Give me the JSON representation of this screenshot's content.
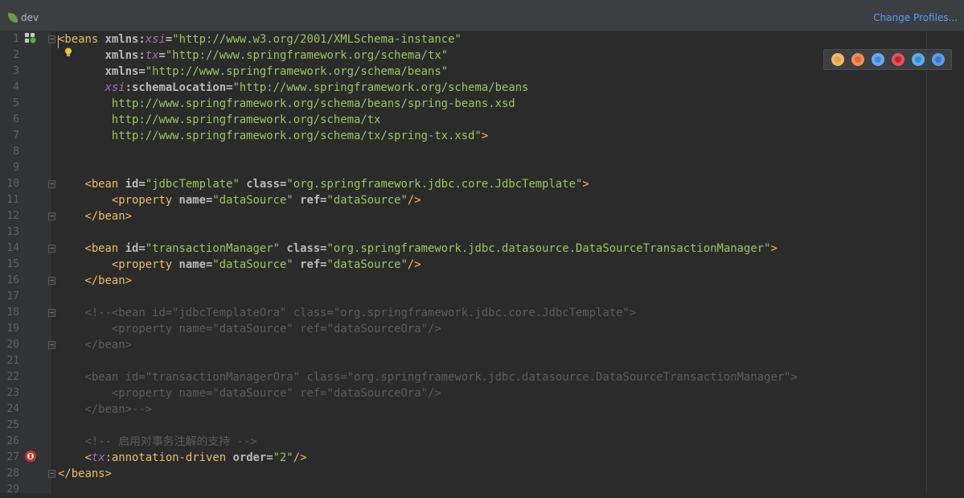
{
  "topbar": {
    "profile_label": "dev",
    "change_profiles_label": "Change Profiles..."
  },
  "browsers": [
    {
      "name": "chrome-icon",
      "color": "#e8a33a"
    },
    {
      "name": "firefox-icon",
      "color": "#e46a28"
    },
    {
      "name": "safari-icon",
      "color": "#3c8be0"
    },
    {
      "name": "opera-icon",
      "color": "#cc1f2a"
    },
    {
      "name": "ie-icon",
      "color": "#2d8fe0"
    },
    {
      "name": "edge-icon",
      "color": "#2b7bd6"
    }
  ],
  "lines": [
    {
      "n": "1",
      "parts": [
        [
          "t-tag",
          "<beans "
        ],
        [
          "t-attr",
          "xmlns:"
        ],
        [
          "t-ns",
          "xsi"
        ],
        [
          "t-attr",
          "="
        ],
        [
          "val",
          "\"http://www.w3.org/2001/XMLSchema-instance\""
        ]
      ]
    },
    {
      "n": "2",
      "parts": [
        [
          "t-plain",
          "       "
        ],
        [
          "t-attr",
          "xmlns:"
        ],
        [
          "t-ns",
          "tx"
        ],
        [
          "t-attr",
          "="
        ],
        [
          "val",
          "\"http://www.springframework.org/schema/tx\""
        ]
      ]
    },
    {
      "n": "3",
      "parts": [
        [
          "t-plain",
          "       "
        ],
        [
          "t-attr",
          "xmlns"
        ],
        [
          "t-attr",
          "="
        ],
        [
          "val",
          "\"http://www.springframework.org/schema/beans\""
        ]
      ]
    },
    {
      "n": "4",
      "parts": [
        [
          "t-plain",
          "       "
        ],
        [
          "t-ns",
          "xsi"
        ],
        [
          "t-attr",
          ":schemaLocation="
        ],
        [
          "val",
          "\"http://www.springframework.org/schema/beans"
        ]
      ]
    },
    {
      "n": "5",
      "parts": [
        [
          "val",
          "        http://www.springframework.org/schema/beans/spring-beans.xsd"
        ]
      ]
    },
    {
      "n": "6",
      "parts": [
        [
          "val",
          "        http://www.springframework.org/schema/tx"
        ]
      ]
    },
    {
      "n": "7",
      "parts": [
        [
          "val",
          "        http://www.springframework.org/schema/tx/spring-tx.xsd\""
        ],
        [
          "t-tag",
          ">"
        ]
      ]
    },
    {
      "n": "8",
      "parts": []
    },
    {
      "n": "9",
      "parts": []
    },
    {
      "n": "10",
      "parts": [
        [
          "t-plain",
          "    "
        ],
        [
          "t-tag",
          "<bean "
        ],
        [
          "t-attr",
          "id="
        ],
        [
          "val",
          "\"jdbcTemplate\" "
        ],
        [
          "t-attr",
          "class="
        ],
        [
          "val",
          "\"org.springframework.jdbc.core.JdbcTemplate\""
        ],
        [
          "t-tag",
          ">"
        ]
      ]
    },
    {
      "n": "11",
      "parts": [
        [
          "t-plain",
          "        "
        ],
        [
          "t-tag",
          "<property "
        ],
        [
          "t-attr",
          "name="
        ],
        [
          "val",
          "\"dataSource\" "
        ],
        [
          "t-attr",
          "ref="
        ],
        [
          "val",
          "\"dataSource\""
        ],
        [
          "t-tag",
          "/>"
        ]
      ]
    },
    {
      "n": "12",
      "parts": [
        [
          "t-plain",
          "    "
        ],
        [
          "t-tag",
          "</bean>"
        ]
      ]
    },
    {
      "n": "13",
      "parts": []
    },
    {
      "n": "14",
      "parts": [
        [
          "t-plain",
          "    "
        ],
        [
          "t-tag",
          "<bean "
        ],
        [
          "t-attr",
          "id="
        ],
        [
          "val",
          "\"transactionManager\" "
        ],
        [
          "t-attr",
          "class="
        ],
        [
          "val",
          "\"org.springframework.jdbc.datasource.DataSourceTransactionManager\""
        ],
        [
          "t-tag",
          ">"
        ]
      ]
    },
    {
      "n": "15",
      "parts": [
        [
          "t-plain",
          "        "
        ],
        [
          "t-tag",
          "<property "
        ],
        [
          "t-attr",
          "name="
        ],
        [
          "val",
          "\"dataSource\" "
        ],
        [
          "t-attr",
          "ref="
        ],
        [
          "val",
          "\"dataSource\""
        ],
        [
          "t-tag",
          "/>"
        ]
      ]
    },
    {
      "n": "16",
      "parts": [
        [
          "t-plain",
          "    "
        ],
        [
          "t-tag",
          "</bean>"
        ]
      ]
    },
    {
      "n": "17",
      "parts": []
    },
    {
      "n": "18",
      "parts": [
        [
          "t-plain",
          "    "
        ],
        [
          "t-cmt",
          "<!--<bean id=\"jdbcTemplateOra\" class=\"org.springframework.jdbc.core.JdbcTemplate\">"
        ]
      ]
    },
    {
      "n": "19",
      "parts": [
        [
          "t-plain",
          "        "
        ],
        [
          "t-cmt",
          "<property name=\"dataSource\" ref=\"dataSourceOra\"/>"
        ]
      ]
    },
    {
      "n": "20",
      "parts": [
        [
          "t-plain",
          "    "
        ],
        [
          "t-cmt",
          "</bean>"
        ]
      ]
    },
    {
      "n": "21",
      "parts": []
    },
    {
      "n": "22",
      "parts": [
        [
          "t-plain",
          "    "
        ],
        [
          "t-cmt",
          "<bean id=\"transactionManagerOra\" class=\"org.springframework.jdbc.datasource.DataSourceTransactionManager\">"
        ]
      ]
    },
    {
      "n": "23",
      "parts": [
        [
          "t-plain",
          "        "
        ],
        [
          "t-cmt",
          "<property name=\"dataSource\" ref=\"dataSourceOra\"/>"
        ]
      ]
    },
    {
      "n": "24",
      "parts": [
        [
          "t-plain",
          "    "
        ],
        [
          "t-cmt",
          "</bean>-->"
        ]
      ]
    },
    {
      "n": "25",
      "parts": []
    },
    {
      "n": "26",
      "parts": [
        [
          "t-plain",
          "    "
        ],
        [
          "t-cmt",
          "<!-- 启用对事务注解的支持 -->"
        ]
      ]
    },
    {
      "n": "27",
      "parts": [
        [
          "t-plain",
          "    "
        ],
        [
          "t-tag",
          "<"
        ],
        [
          "t-ns",
          "tx"
        ],
        [
          "t-tag",
          ":annotation-driven "
        ],
        [
          "t-attr",
          "order="
        ],
        [
          "val",
          "\"2\""
        ],
        [
          "t-tag",
          "/>"
        ]
      ]
    },
    {
      "n": "28",
      "parts": [
        [
          "t-tag",
          "</beans>"
        ]
      ]
    },
    {
      "n": "29",
      "parts": []
    }
  ]
}
